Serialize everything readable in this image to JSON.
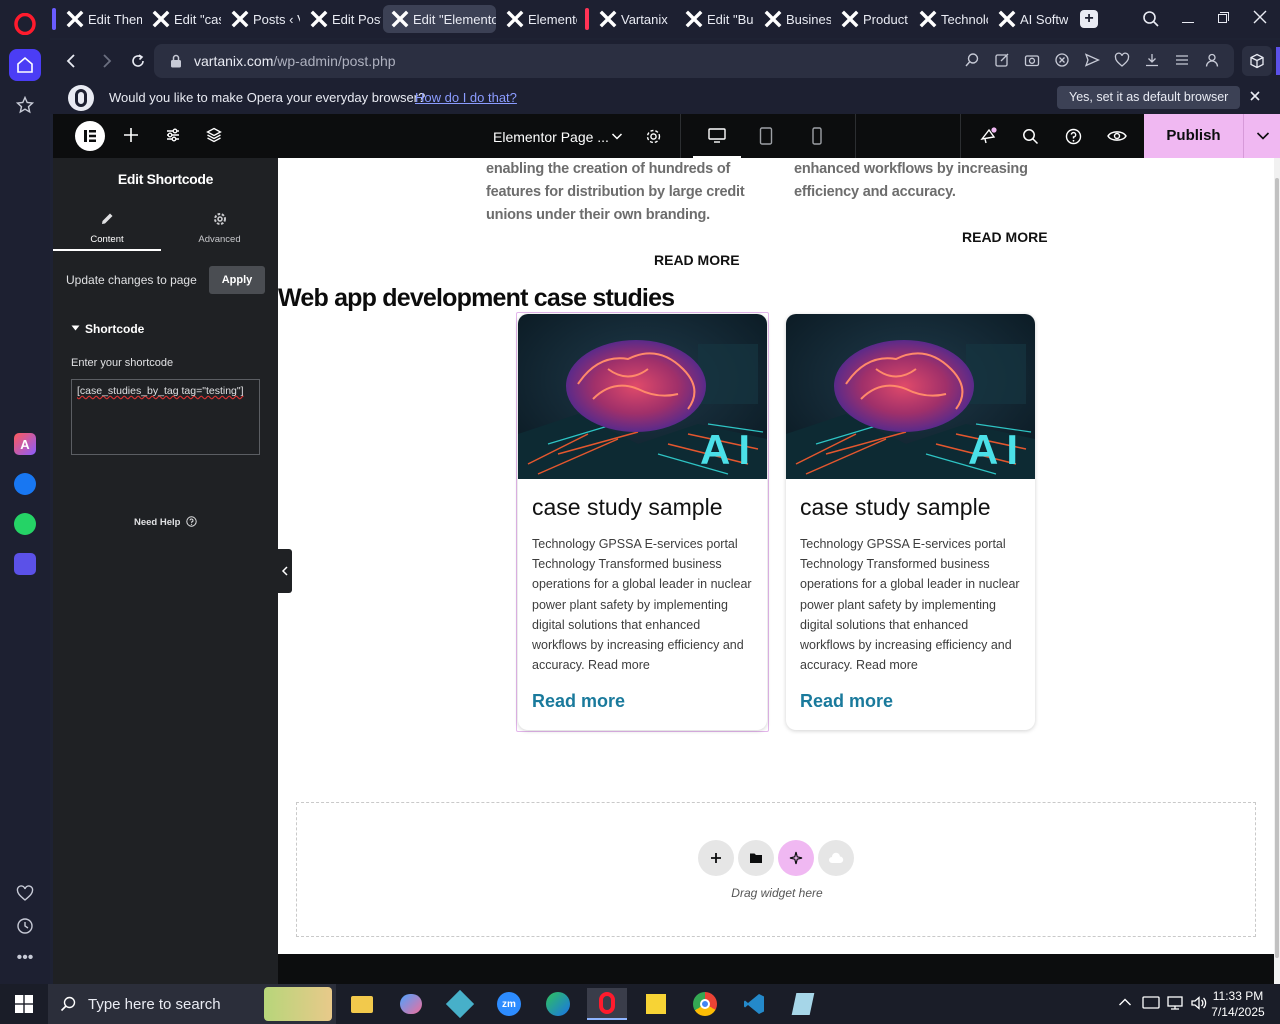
{
  "browser": {
    "tabs": [
      {
        "title": "Edit Them",
        "active": false
      },
      {
        "title": "Edit \"case",
        "active": false
      },
      {
        "title": "Posts ‹ Va",
        "active": false
      },
      {
        "title": "Edit Post",
        "active": false
      },
      {
        "title": "Edit \"Elementor",
        "active": true
      },
      {
        "title": "Elemento",
        "active": false
      },
      {
        "title": "Vartanix",
        "active": false
      },
      {
        "title": "Edit \"Busi",
        "active": false
      },
      {
        "title": "Business",
        "active": false
      },
      {
        "title": "Product",
        "active": false
      },
      {
        "title": "Technolo",
        "active": false
      },
      {
        "title": "AI Softwa",
        "active": false
      }
    ],
    "url_host": "vartanix.com",
    "url_path": "/wp-admin/post.php",
    "banner": {
      "question": "Would you like to make Opera your everyday browser?",
      "link": "How do I do that?",
      "cta": "Yes, set it as default browser"
    }
  },
  "elementor": {
    "doc_title": "Elementor Page ...",
    "publish_label": "Publish",
    "panel": {
      "title": "Edit Shortcode",
      "tab_content": "Content",
      "tab_advanced": "Advanced",
      "update_text": "Update changes to page",
      "apply_label": "Apply",
      "section_title": "Shortcode",
      "field_label": "Enter your shortcode",
      "shortcode_value": "[case_studies_by_tag tag=\"testing\"]",
      "need_help": "Need Help"
    },
    "canvas": {
      "prev_desc_1": "enabling the creation of hundreds of features for distribution by large credit unions under their own branding.",
      "prev_desc_2": "enhanced workflows by increasing efficiency and accuracy.",
      "read_more_1": "READ MORE",
      "read_more_2": "READ MORE",
      "section_heading": "Web app development case studies",
      "image_badge": "AI",
      "cards": [
        {
          "title": "case study sample",
          "desc": "Technology GPSSA E-services portal Technology Transformed business operations for a global leader in nuclear power plant safety by implementing digital solutions that enhanced workflows by increasing efficiency and accuracy.  Read more",
          "link": "Read more"
        },
        {
          "title": "case study sample",
          "desc": "Technology GPSSA E-services portal Technology Transformed business operations for a global leader in nuclear power plant safety by implementing digital solutions that enhanced workflows by increasing efficiency and accuracy.  Read more",
          "link": "Read more"
        }
      ],
      "drop_label": "Drag widget here"
    }
  },
  "taskbar": {
    "search_placeholder": "Type here to search",
    "time": "11:33 PM",
    "date": "7/14/2025"
  },
  "colors": {
    "accent_pink": "#f0b8f2",
    "link_blue": "#1a7a9c",
    "opera_red": "#ff1b2d"
  }
}
